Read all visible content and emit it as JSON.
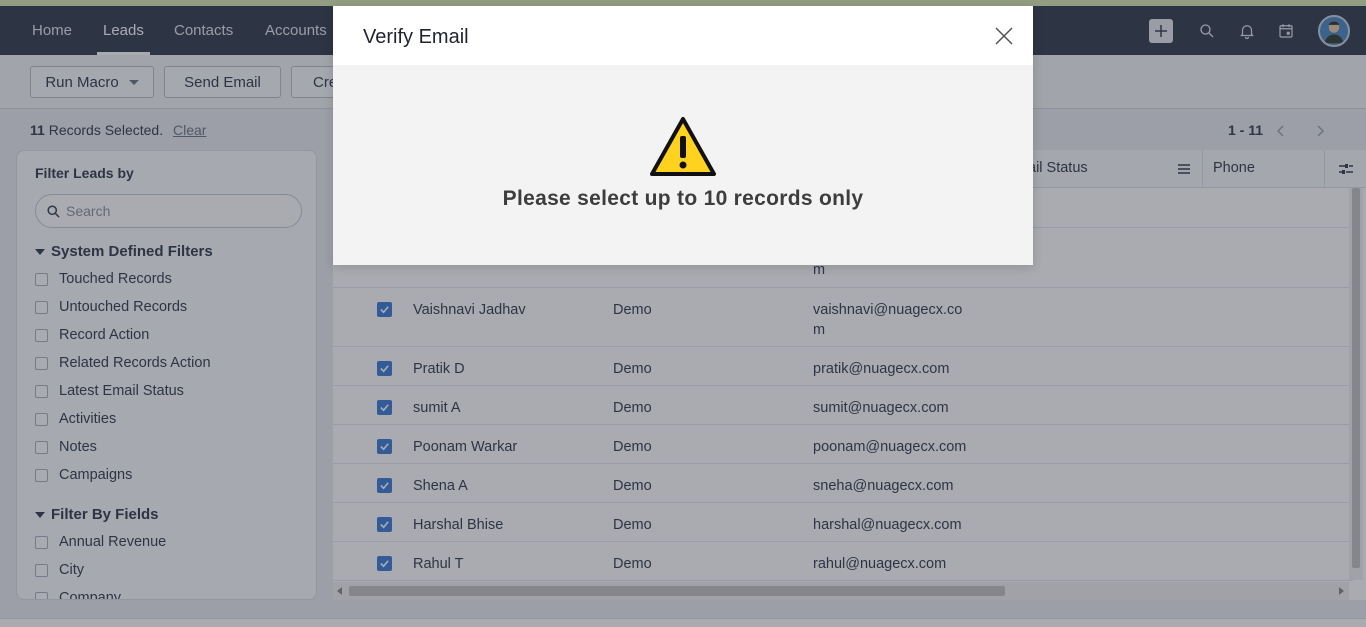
{
  "nav": {
    "items": [
      "Home",
      "Leads",
      "Contacts",
      "Accounts"
    ],
    "active": "Leads"
  },
  "toolbar": {
    "run_macro": "Run Macro",
    "send_email": "Send Email",
    "create_partial": "Cre"
  },
  "selection": {
    "count": "11",
    "label": "Records Selected.",
    "clear": "Clear"
  },
  "pager": {
    "range": "1 - 11"
  },
  "sidebar": {
    "title": "Filter Leads by",
    "search_placeholder": "Search",
    "system_section": "System Defined Filters",
    "system_filters": [
      "Touched Records",
      "Untouched Records",
      "Record Action",
      "Related Records Action",
      "Latest Email Status",
      "Activities",
      "Notes",
      "Campaigns"
    ],
    "fields_section": "Filter By Fields",
    "field_filters": [
      "Annual Revenue",
      "City",
      "Company"
    ]
  },
  "grid": {
    "headers": {
      "email_status": "ail Status",
      "phone": "Phone"
    },
    "partial_row_email_tail": "m",
    "rows": [
      {
        "name": "Vaishnavi Jadhav",
        "company": "Demo",
        "email": "vaishnavi@nuagecx.com"
      },
      {
        "name": "Pratik D",
        "company": "Demo",
        "email": "pratik@nuagecx.com"
      },
      {
        "name": "sumit A",
        "company": "Demo",
        "email": "sumit@nuagecx.com"
      },
      {
        "name": "Poonam Warkar",
        "company": "Demo",
        "email": "poonam@nuagecx.com"
      },
      {
        "name": "Shena A",
        "company": "Demo",
        "email": "sneha@nuagecx.com"
      },
      {
        "name": "Harshal Bhise",
        "company": "Demo",
        "email": "harshal@nuagecx.com"
      },
      {
        "name": "Rahul T",
        "company": "Demo",
        "email": "rahul@nuagecx.com"
      }
    ]
  },
  "modal": {
    "title": "Verify Email",
    "message": "Please select up to 10 records only",
    "icon": "warning-icon"
  },
  "colors": {
    "nav_bg": "#313949",
    "checkbox_blue": "#3a7ad6",
    "warning_yellow": "#ffd21f"
  }
}
